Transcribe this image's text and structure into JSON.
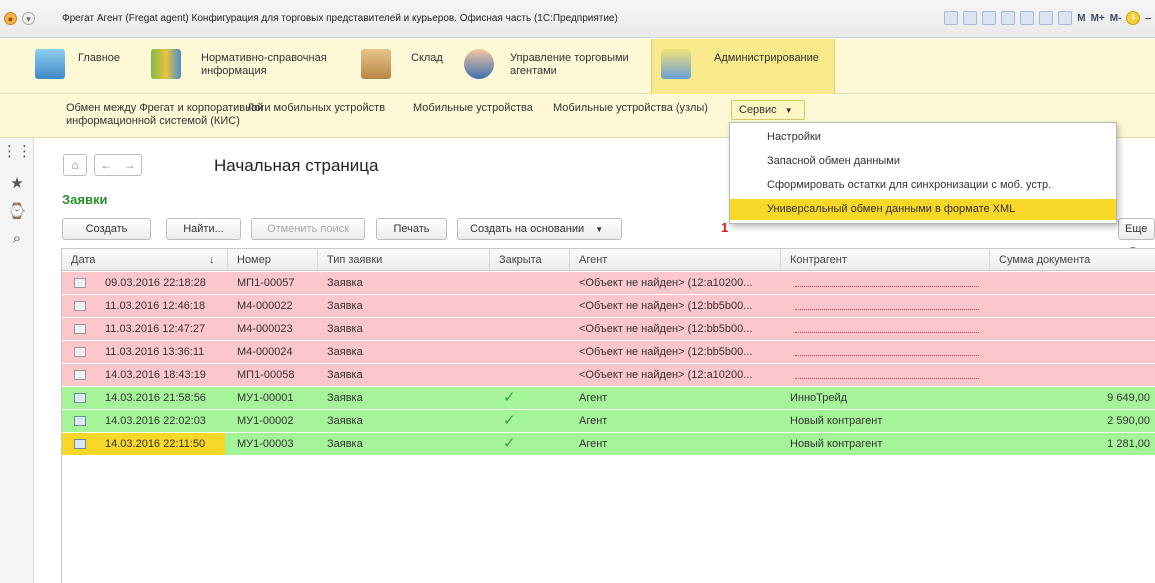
{
  "window": {
    "title": "Фрегат Агент (Fregat agent) Конфигурация для торговых представителей и курьеров. Офисная часть  (1С:Предприятие)",
    "toolbar_text": [
      "M",
      "M+",
      "M-"
    ]
  },
  "sections": [
    {
      "label": "Главное",
      "icon": "main-section-icon"
    },
    {
      "label": "Нормативно-справочная\nинформация",
      "icon": "reference-books-icon"
    },
    {
      "label": "Склад",
      "icon": "warehouse-icon"
    },
    {
      "label": "Управление торговыми\nагентами",
      "icon": "agent-icon"
    },
    {
      "label": "Администрирование",
      "icon": "database-icon",
      "active": true
    }
  ],
  "commands": [
    {
      "label": "Обмен между Фрегат и корпоративной\nинформационной системой (КИС)"
    },
    {
      "label": "Логи мобильных устройств"
    },
    {
      "label": "Мобильные устройства"
    },
    {
      "label": "Мобильные устройства (узлы)"
    }
  ],
  "service_menu": {
    "label": "Сервис",
    "items": [
      "Настройки",
      "Запасной обмен данными",
      "Сформировать остатки для синхронизации с моб. устр.",
      "Универсальный обмен данными в формате XML"
    ],
    "highlighted_index": 3
  },
  "marker": "1",
  "form": {
    "title": "Начальная страница",
    "section_title": "Заявки"
  },
  "buttons": {
    "create": "Создать",
    "find": "Найти...",
    "cancel_search": "Отменить поиск",
    "print": "Печать",
    "create_based_on": "Создать на основании",
    "more": "Еще"
  },
  "table": {
    "columns": [
      "Дата",
      "Номер",
      "Тип заявки",
      "Закрыта",
      "Агент",
      "Контрагент",
      "Сумма документа"
    ],
    "sort_indicator": "↓",
    "rows": [
      {
        "date": "09.03.2016 22:18:28",
        "number": "МП1-00057",
        "type": "Заявка",
        "closed": "",
        "agent": "<Объект не найден> (12:a10200...",
        "counterparty": "",
        "sum": "",
        "status": "error"
      },
      {
        "date": "11.03.2016 12:46:18",
        "number": "М4-000022",
        "type": "Заявка",
        "closed": "",
        "agent": "<Объект не найден> (12:bb5b00...",
        "counterparty": "",
        "sum": "",
        "status": "error"
      },
      {
        "date": "11.03.2016 12:47:27",
        "number": "М4-000023",
        "type": "Заявка",
        "closed": "",
        "agent": "<Объект не найден> (12:bb5b00...",
        "counterparty": "",
        "sum": "",
        "status": "error"
      },
      {
        "date": "11.03.2016 13:36:11",
        "number": "М4-000024",
        "type": "Заявка",
        "closed": "",
        "agent": "<Объект не найден> (12:bb5b00...",
        "counterparty": "",
        "sum": "",
        "status": "error"
      },
      {
        "date": "14.03.2016 18:43:19",
        "number": "МП1-00058",
        "type": "Заявка",
        "closed": "",
        "agent": "<Объект не найден> (12:a10200...",
        "counterparty": "",
        "sum": "",
        "status": "error"
      },
      {
        "date": "14.03.2016 21:58:56",
        "number": "МУ1-00001",
        "type": "Заявка",
        "closed": "✓",
        "agent": "Агент",
        "counterparty": "ИнноТрейд",
        "sum": "9 649,00",
        "status": "ok"
      },
      {
        "date": "14.03.2016 22:02:03",
        "number": "МУ1-00002",
        "type": "Заявка",
        "closed": "✓",
        "agent": "Агент",
        "counterparty": "Новый контрагент",
        "sum": "2 590,00",
        "status": "ok"
      },
      {
        "date": "14.03.2016 22:11:50",
        "number": "МУ1-00003",
        "type": "Заявка",
        "closed": "✓",
        "agent": "Агент",
        "counterparty": "Новый контрагент",
        "sum": "1 281,00",
        "status": "ok",
        "selected": true
      }
    ]
  },
  "colors": {
    "accent_yellow": "#f7d727",
    "panel_yellow": "#fdf9d6",
    "row_error": "#fbc6cc",
    "row_ok": "#a6f49a",
    "section_title_green": "#2c8f2c",
    "marker_red": "#e01b1b"
  }
}
